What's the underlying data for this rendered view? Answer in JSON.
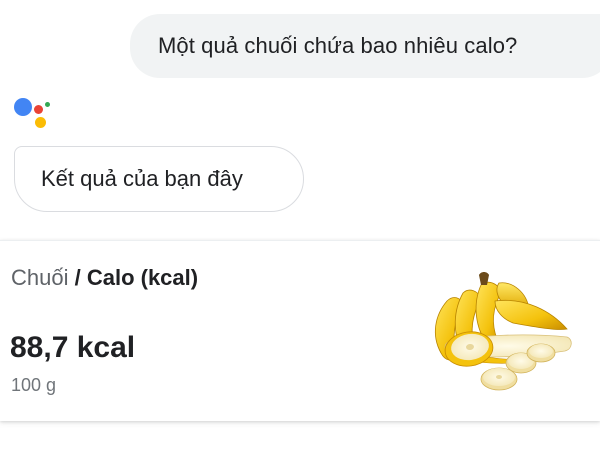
{
  "conversation": {
    "user_query": "Một quả chuối chứa bao nhiêu calo?",
    "assistant_reply": "Kết quả của bạn đây"
  },
  "answer_card": {
    "entity": "Chuối",
    "separator": " / ",
    "attribute": "Calo (kcal)",
    "value": "88,7 kcal",
    "serving": "100 g",
    "image": "banana-icon"
  },
  "colors": {
    "assistant_blue": "#4285f4",
    "assistant_red": "#ea4335",
    "assistant_yellow": "#fbbc05",
    "assistant_green": "#34a853",
    "banana_yellow": "#f4c20d"
  }
}
